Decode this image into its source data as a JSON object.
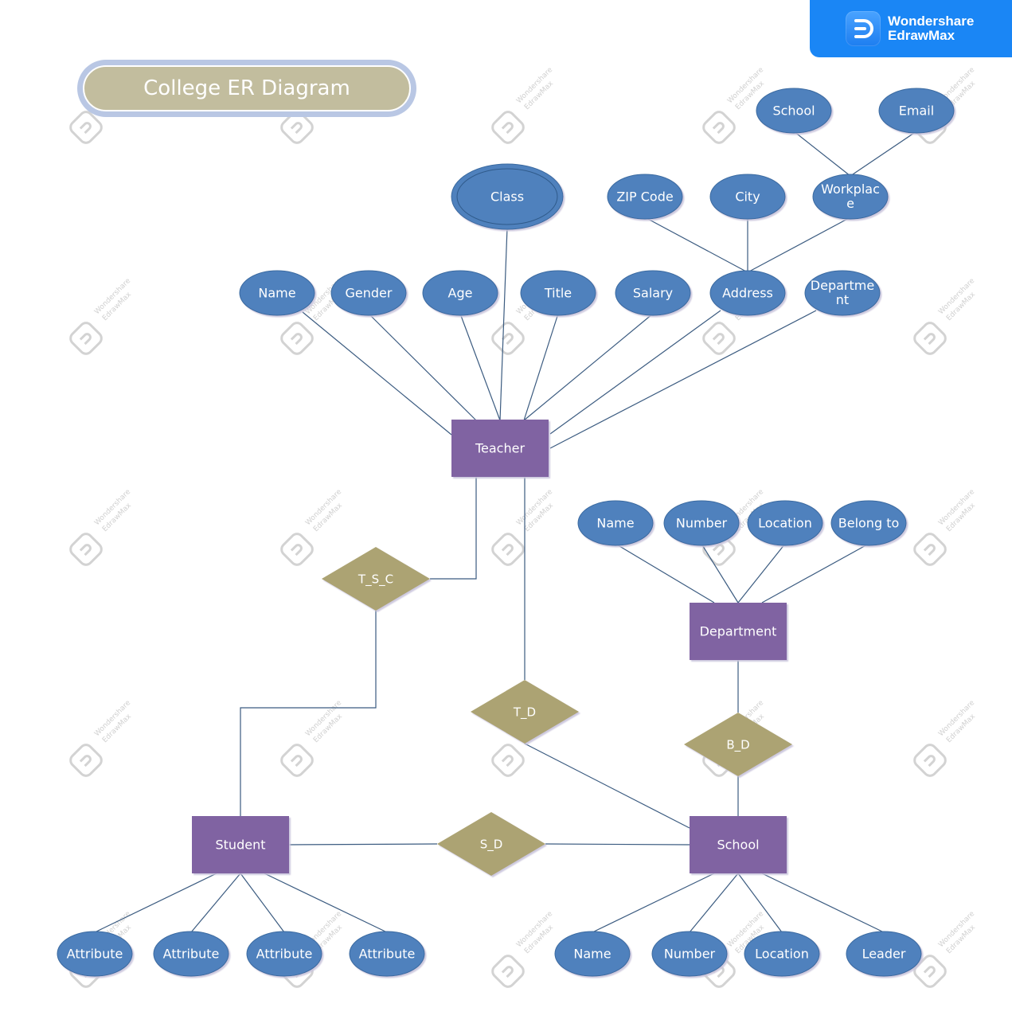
{
  "brand": {
    "line1": "Wondershare",
    "line2": "EdrawMax",
    "color": "#1a86f5"
  },
  "title": "College ER Diagram",
  "watermark": {
    "line1": "Wondershare",
    "line2": "EdrawMax"
  },
  "colors": {
    "entity": "#8064a2",
    "attribute": "#4f81bd",
    "relationship": "#aca373",
    "line": "#3b5b80"
  },
  "entities": [
    {
      "id": "teacher",
      "label": "Teacher"
    },
    {
      "id": "department",
      "label": "Department"
    },
    {
      "id": "student",
      "label": "Student"
    },
    {
      "id": "school",
      "label": "School"
    }
  ],
  "relationships": [
    {
      "id": "tsc",
      "label": "T_S_C",
      "connects": [
        "teacher",
        "student"
      ]
    },
    {
      "id": "td",
      "label": "T_D",
      "connects": [
        "teacher",
        "school"
      ]
    },
    {
      "id": "bd",
      "label": "B_D",
      "connects": [
        "department",
        "school"
      ]
    },
    {
      "id": "sd",
      "label": "S_D",
      "connects": [
        "student",
        "school"
      ]
    }
  ],
  "attributes": [
    {
      "id": "t-name",
      "label": "Name",
      "parent": "teacher"
    },
    {
      "id": "t-gender",
      "label": "Gender",
      "parent": "teacher"
    },
    {
      "id": "t-age",
      "label": "Age",
      "parent": "teacher"
    },
    {
      "id": "t-class",
      "label": "Class",
      "parent": "teacher",
      "multivalued": true
    },
    {
      "id": "t-title",
      "label": "Title",
      "parent": "teacher"
    },
    {
      "id": "t-salary",
      "label": "Salary",
      "parent": "teacher"
    },
    {
      "id": "t-address",
      "label": "Address",
      "parent": "teacher"
    },
    {
      "id": "t-department",
      "label": "Departme nt",
      "parent": "teacher"
    },
    {
      "id": "a-zip",
      "label": "ZIP Code",
      "parent": "t-address"
    },
    {
      "id": "a-city",
      "label": "City",
      "parent": "t-address"
    },
    {
      "id": "a-workplace",
      "label": "Workplac e",
      "parent": "t-address"
    },
    {
      "id": "w-school",
      "label": "School",
      "parent": "a-workplace"
    },
    {
      "id": "w-email",
      "label": "Email",
      "parent": "a-workplace"
    },
    {
      "id": "d-name",
      "label": "Name",
      "parent": "department"
    },
    {
      "id": "d-number",
      "label": "Number",
      "parent": "department"
    },
    {
      "id": "d-location",
      "label": "Location",
      "parent": "department"
    },
    {
      "id": "d-belong",
      "label": "Belong to",
      "parent": "department"
    },
    {
      "id": "s-attr1",
      "label": "Attribute",
      "parent": "student"
    },
    {
      "id": "s-attr2",
      "label": "Attribute",
      "parent": "student"
    },
    {
      "id": "s-attr3",
      "label": "Attribute",
      "parent": "student"
    },
    {
      "id": "s-attr4",
      "label": "Attribute",
      "parent": "student"
    },
    {
      "id": "sc-name",
      "label": "Name",
      "parent": "school"
    },
    {
      "id": "sc-number",
      "label": "Number",
      "parent": "school"
    },
    {
      "id": "sc-location",
      "label": "Location",
      "parent": "school"
    },
    {
      "id": "sc-leader",
      "label": "Leader",
      "parent": "school"
    }
  ]
}
